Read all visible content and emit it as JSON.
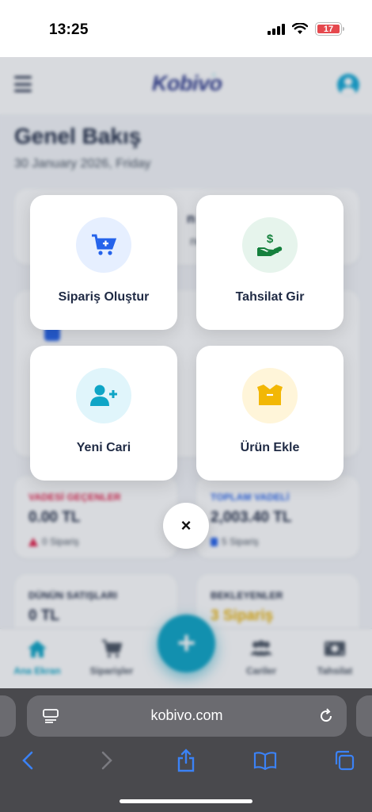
{
  "status_bar": {
    "time": "13:25",
    "battery_level": "17",
    "battery_color": "#e5484d"
  },
  "header": {
    "brand": "Kobivo",
    "menu_icon": "hamburger-icon",
    "profile_icon": "user-avatar-icon"
  },
  "page": {
    "title": "Genel Bakış",
    "date": "30 January 2026, Friday"
  },
  "background_cards": {
    "partial_title": "n Ge",
    "partial_sub": "nce",
    "overdue": {
      "label": "VADESİ GEÇENLER",
      "value": "0.00 TL",
      "sub": "0 Sipariş",
      "label_color": "#e11d48"
    },
    "total_due": {
      "label": "TOPLAM VADELİ",
      "value": "2,003.40 TL",
      "sub": "5 Sipariş",
      "label_color": "#2563eb"
    },
    "yesterday_sales": {
      "label": "DÜNÜN SATIŞLARI",
      "value": "0 TL"
    },
    "pending": {
      "label": "BEKLEYENLER",
      "value": "3 Sipariş",
      "value_color": "#eab308"
    }
  },
  "quick_actions": [
    {
      "label": "Sipariş Oluştur",
      "icon": "cart-plus-icon",
      "color": "#2563eb",
      "bg": "#e6efff"
    },
    {
      "label": "Tahsilat Gir",
      "icon": "hand-money-icon",
      "color": "#15803d",
      "bg": "#e6f4ec"
    },
    {
      "label": "Yeni Cari",
      "icon": "user-plus-icon",
      "color": "#0ea5c6",
      "bg": "#e0f5fb"
    },
    {
      "label": "Ürün Ekle",
      "icon": "box-icon",
      "color": "#f2b705",
      "bg": "#fff5d9"
    }
  ],
  "close_label": "×",
  "fab_label": "+",
  "bottom_nav": [
    {
      "label": "Ana Ekran",
      "icon": "home-icon",
      "active": true
    },
    {
      "label": "Siparişler",
      "icon": "cart-icon",
      "active": false
    },
    {
      "label": "Cariler",
      "icon": "users-icon",
      "active": false
    },
    {
      "label": "Tahsilat",
      "icon": "cash-icon",
      "active": false
    }
  ],
  "browser": {
    "url": "kobivo.com"
  }
}
